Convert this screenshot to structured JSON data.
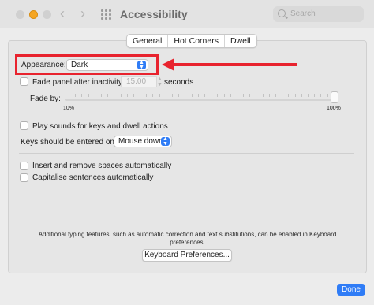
{
  "window": {
    "title": "Accessibility",
    "search_placeholder": "Search"
  },
  "tabs": [
    {
      "label": "General",
      "selected": true
    },
    {
      "label": "Hot Corners",
      "selected": false
    },
    {
      "label": "Dwell",
      "selected": false
    }
  ],
  "appearance": {
    "label": "Appearance:",
    "value": "Dark"
  },
  "fade": {
    "checkbox_label": "Fade panel after inactivity:",
    "checked": false,
    "value": "15.00",
    "unit": "seconds",
    "fade_by_label": "Fade by:",
    "min_label": "10%",
    "max_label": "100%",
    "slider_value_percent": 100
  },
  "sounds": {
    "label": "Play sounds for keys and dwell actions",
    "checked": false
  },
  "keys_entered": {
    "label": "Keys should be entered on:",
    "value": "Mouse down"
  },
  "spaces": {
    "label": "Insert and remove spaces automatically",
    "checked": false
  },
  "capitalise": {
    "label": "Capitalise sentences automatically",
    "checked": false
  },
  "info_text": "Additional typing features, such as automatic correction and text substitutions, can be enabled in Keyboard preferences.",
  "keyboard_prefs_button": "Keyboard Preferences...",
  "done_button": "Done",
  "colors": {
    "annotation_red": "#e8232e",
    "accent_blue": "#2f7cf6"
  },
  "icons": [
    "back-arrow-icon",
    "forward-arrow-icon",
    "grid-icon",
    "search-icon"
  ]
}
